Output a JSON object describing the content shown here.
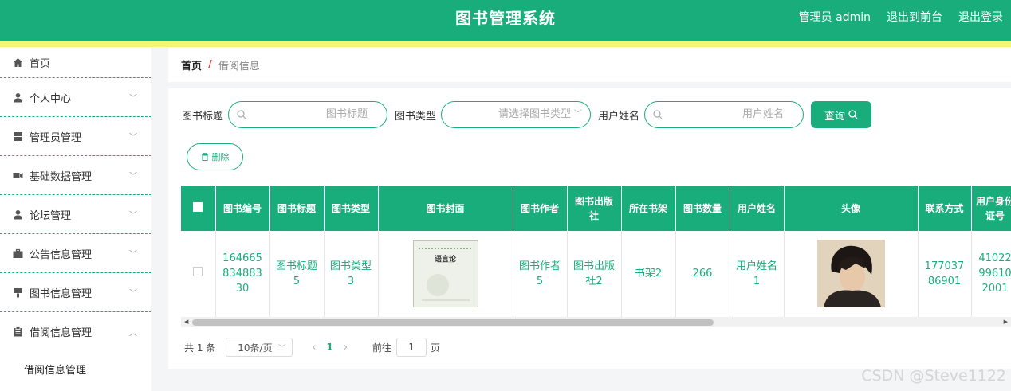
{
  "header": {
    "title": "图书管理系统",
    "admin": "管理员 admin",
    "to_front": "退出到前台",
    "logout": "退出登录"
  },
  "colors": {
    "primary": "#1aad7c",
    "accent_bar": "#f5f574",
    "breadcrumb_separator": "#e6423b"
  },
  "sidebar": {
    "items": [
      {
        "label": "首页",
        "icon": "home-icon"
      },
      {
        "label": "个人中心",
        "icon": "user-icon"
      },
      {
        "label": "管理员管理",
        "icon": "grid-icon"
      },
      {
        "label": "基础数据管理",
        "icon": "video-icon"
      },
      {
        "label": "论坛管理",
        "icon": "user-icon"
      },
      {
        "label": "公告信息管理",
        "icon": "briefcase-icon"
      },
      {
        "label": "图书信息管理",
        "icon": "brush-icon"
      },
      {
        "label": "借阅信息管理",
        "icon": "clipboard-icon",
        "expanded": true
      }
    ],
    "submenu": [
      {
        "label": "借阅信息管理"
      }
    ]
  },
  "breadcrumb": {
    "home": "首页",
    "separator": "/",
    "current": "借阅信息"
  },
  "search": {
    "title_label": "图书标题",
    "title_placeholder": "图书标题",
    "type_label": "图书类型",
    "type_placeholder": "请选择图书类型",
    "user_label": "用户姓名",
    "user_placeholder": "用户姓名",
    "query_button": "查询"
  },
  "actions": {
    "delete": "删除"
  },
  "table": {
    "columns": [
      "图书编号",
      "图书标题",
      "图书类型",
      "图书封面",
      "图书作者",
      "图书出版社",
      "所在书架",
      "图书数量",
      "用户姓名",
      "头像",
      "联系方式",
      "用户身份证号"
    ],
    "rows": [
      {
        "book_no": "16466583488330",
        "title": "图书标题5",
        "type": "图书类型3",
        "cover_text": "语言论",
        "author": "图书作者5",
        "publisher": "图书出版社2",
        "shelf": "书架2",
        "quantity": "266",
        "user_name": "用户姓名1",
        "phone": "17703786901",
        "id_card": "41022996102001"
      }
    ]
  },
  "pagination": {
    "total": "共 1 条",
    "page_size": "10条/页",
    "current_page": "1",
    "goto_label": "前往",
    "goto_value": "1",
    "page_suffix": "页"
  },
  "watermark": "CSDN @Steve1122"
}
